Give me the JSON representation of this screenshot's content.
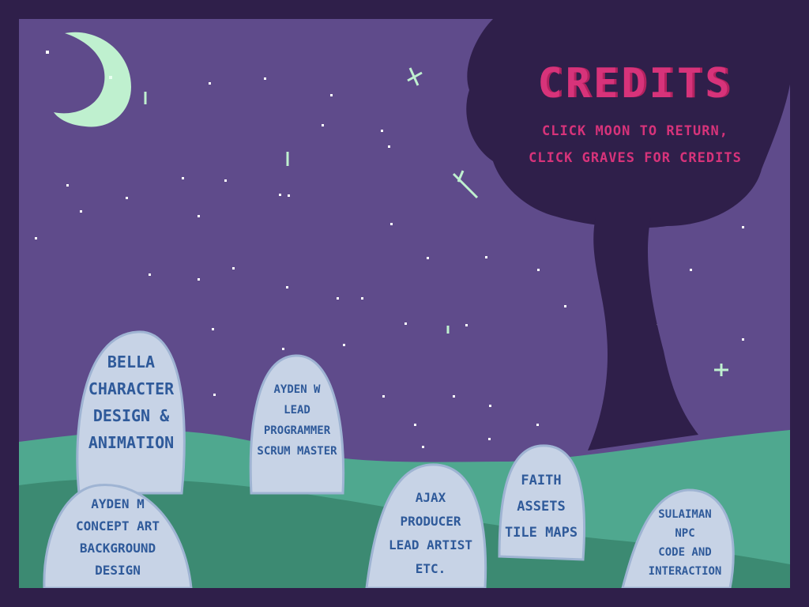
{
  "title": "CREDITS",
  "instructions": [
    "CLICK MOON TO RETURN,",
    "CLICK GRAVES FOR CREDITS"
  ],
  "colors": {
    "sky": "#5f4b8b",
    "frame": "#2f1f4a",
    "title": "#d7337a",
    "grass_light": "#4fa88f",
    "grass_dark": "#3c8a72",
    "stone": "#c7d3e6",
    "stone_text": "#2f5a9a",
    "moon": "#bff0cf",
    "tree": "#2f1f4a"
  },
  "icons": {
    "moon": "crescent-moon-icon"
  },
  "graves": [
    {
      "id": "bella",
      "lines": [
        "BELLA",
        "CHARACTER",
        "DESIGN &",
        "ANIMATION"
      ]
    },
    {
      "id": "aydenw",
      "lines": [
        "AYDEN W",
        "LEAD",
        "PROGRAMMER",
        "SCRUM MASTER"
      ]
    },
    {
      "id": "aydenm",
      "lines": [
        "AYDEN M",
        "CONCEPT ART",
        "BACKGROUND",
        "DESIGN"
      ]
    },
    {
      "id": "ajax",
      "lines": [
        "AJAX",
        "PRODUCER",
        "LEAD ARTIST",
        "ETC."
      ]
    },
    {
      "id": "faith",
      "lines": [
        "FAITH",
        "ASSETS",
        "TILE MAPS"
      ]
    },
    {
      "id": "sulaiman",
      "lines": [
        "SULAIMAN",
        "NPC",
        "CODE AND",
        "INTERACTION"
      ]
    }
  ]
}
